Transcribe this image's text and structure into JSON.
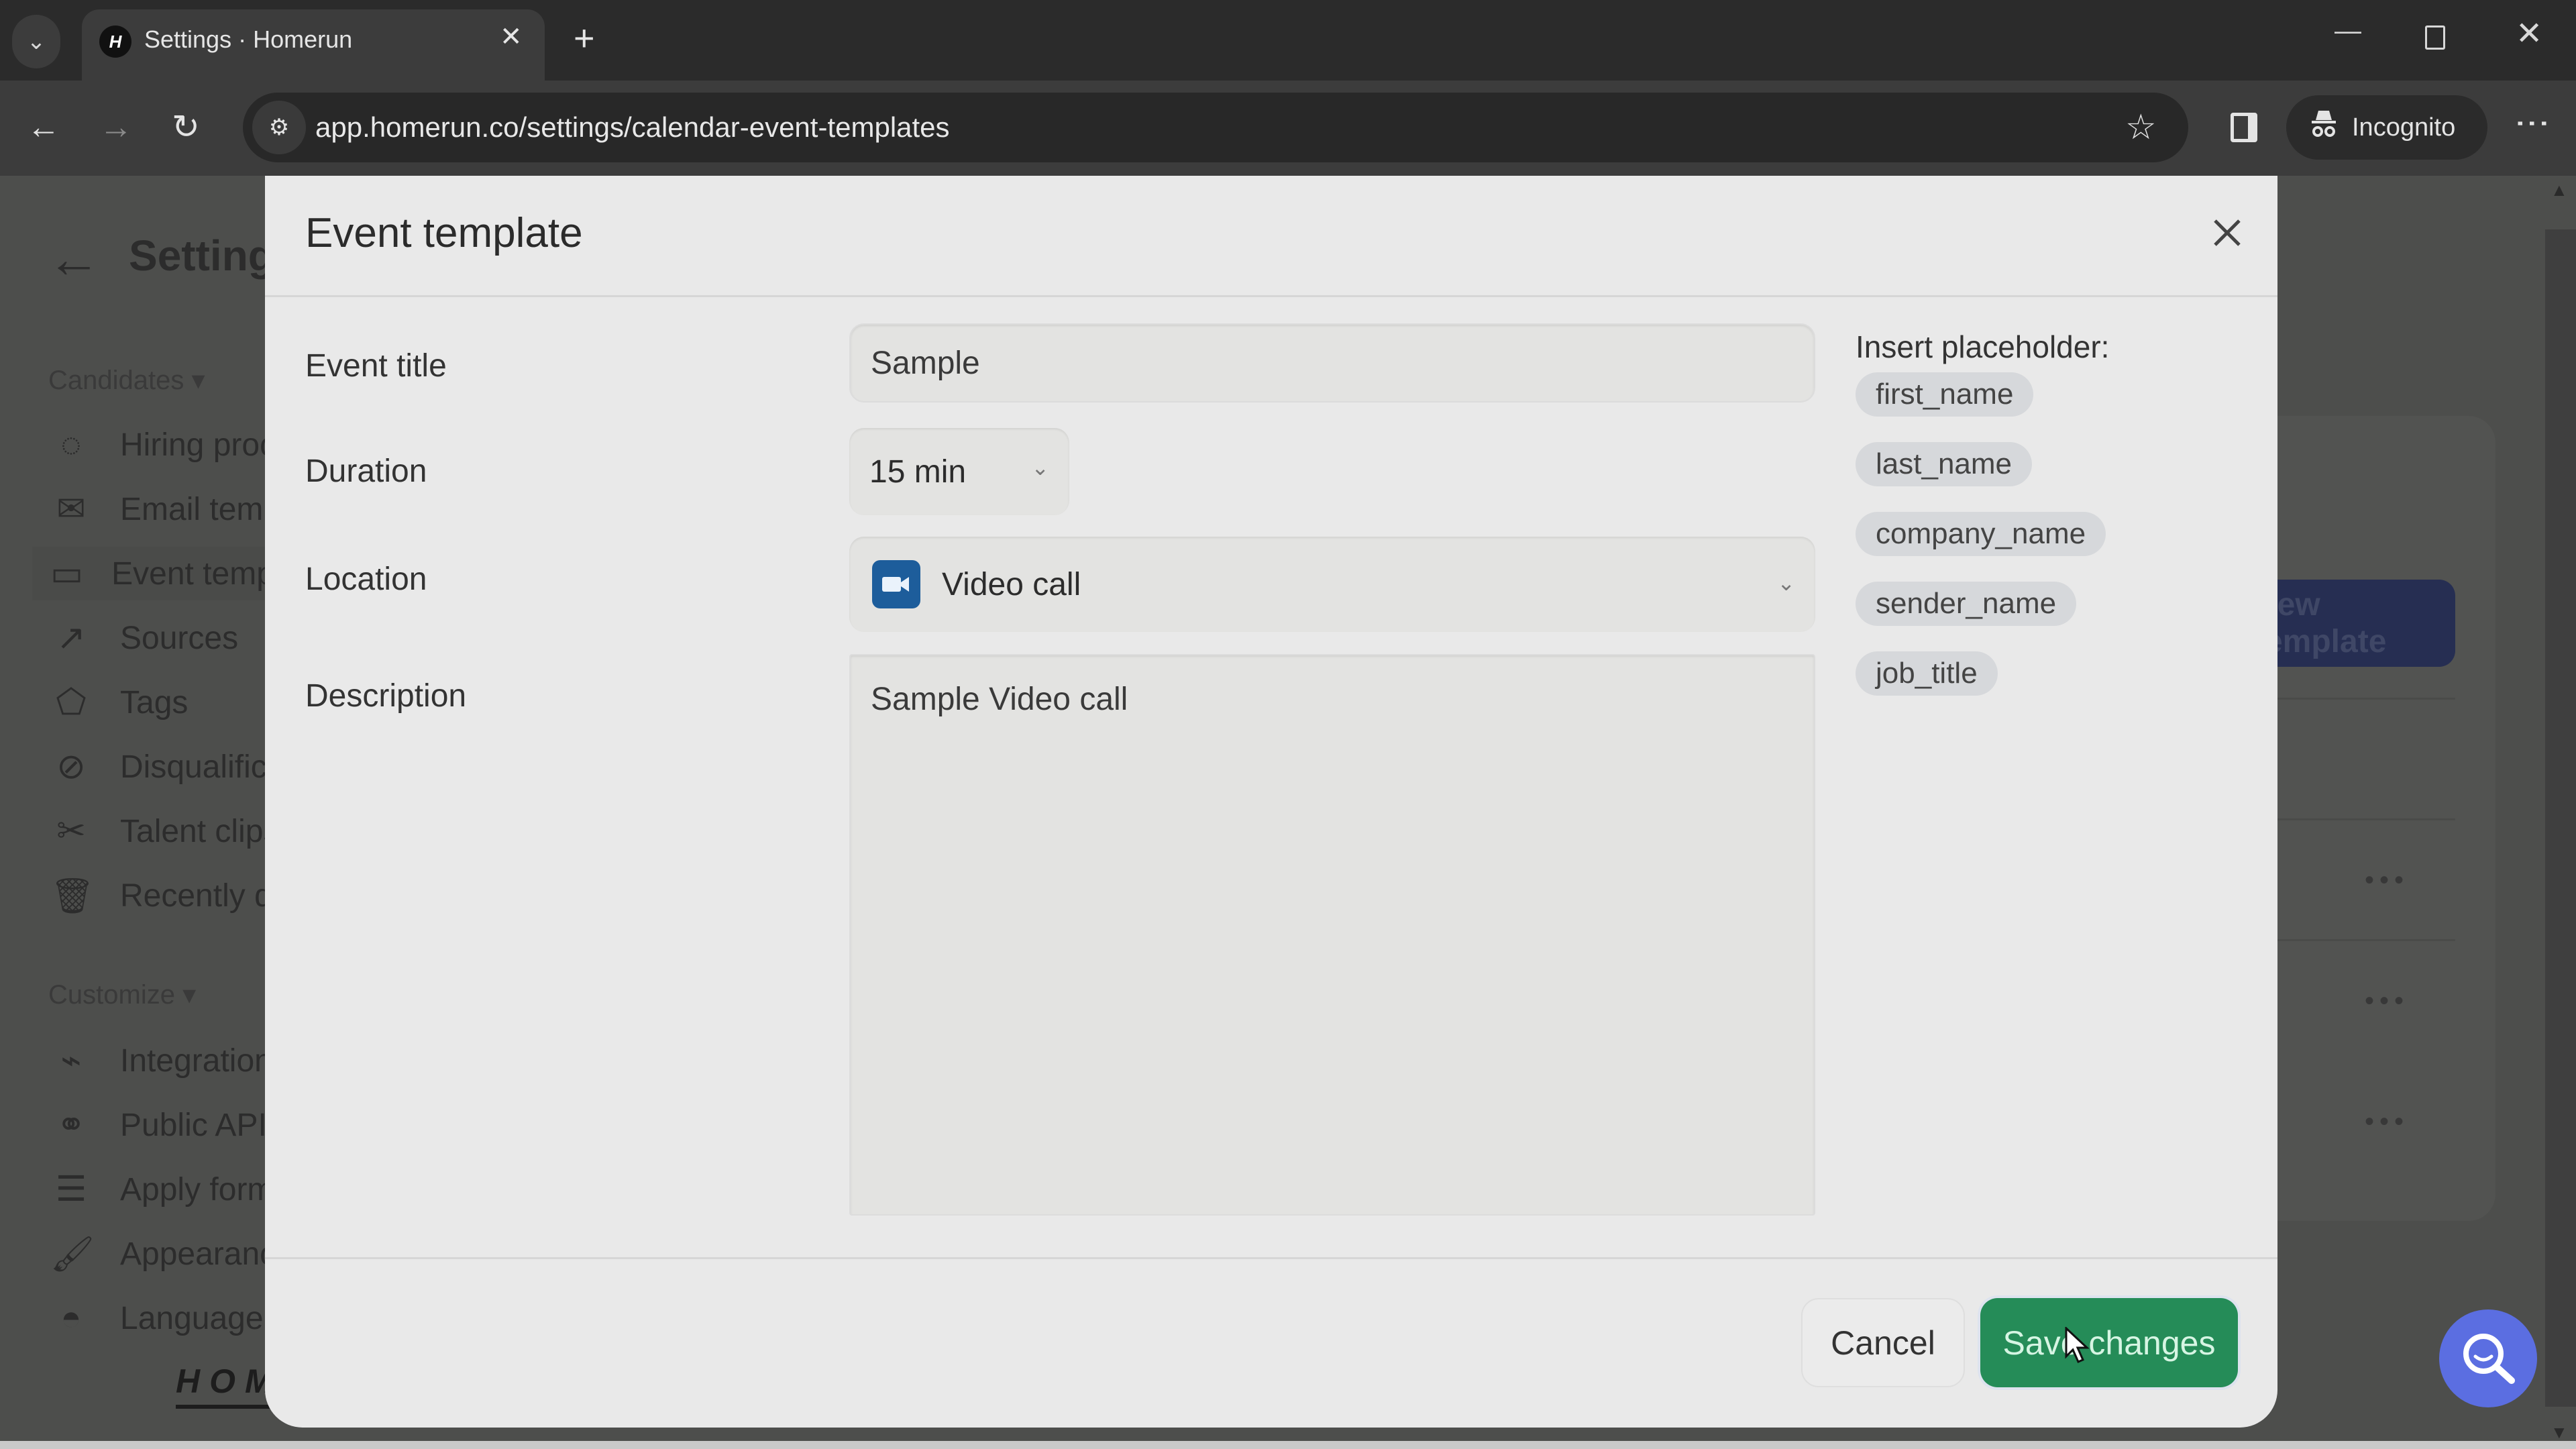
{
  "browser": {
    "tab_title": "Settings · Homerun",
    "favicon_letter": "H",
    "url": "app.homerun.co/settings/calendar-event-templates",
    "incognito_label": "Incognito"
  },
  "background": {
    "settings_title": "Settings",
    "sections": [
      {
        "label": "Candidates",
        "items": [
          {
            "label": "Hiring process",
            "icon": "hiring-process-icon"
          },
          {
            "label": "Email templates",
            "icon": "mail-icon"
          },
          {
            "label": "Event templates",
            "icon": "calendar-icon",
            "active": true
          },
          {
            "label": "Sources",
            "icon": "sources-icon"
          },
          {
            "label": "Tags",
            "icon": "tag-icon"
          },
          {
            "label": "Disqualification reasons",
            "icon": "disqualify-icon"
          },
          {
            "label": "Talent clips",
            "icon": "scissors-icon"
          },
          {
            "label": "Recently deleted",
            "icon": "trash-icon"
          }
        ]
      },
      {
        "label": "Customize",
        "items": [
          {
            "label": "Integrations",
            "icon": "plug-icon"
          },
          {
            "label": "Public API",
            "icon": "api-icon"
          },
          {
            "label": "Apply form",
            "icon": "checklist-icon"
          },
          {
            "label": "Appearance",
            "icon": "brush-icon"
          },
          {
            "label": "Language",
            "icon": "language-icon"
          }
        ]
      }
    ],
    "logo_text": "HOMERUN",
    "new_template_button": "New template"
  },
  "modal": {
    "title": "Event template",
    "fields": {
      "event_title": {
        "label": "Event title",
        "value": "Sample"
      },
      "duration": {
        "label": "Duration",
        "value": "15 min"
      },
      "location": {
        "label": "Location",
        "value": "Video call",
        "icon": "video-camera-icon"
      },
      "description": {
        "label": "Description",
        "value": "Sample Video call"
      }
    },
    "placeholders": {
      "heading": "Insert placeholder:",
      "chips": [
        "first_name",
        "last_name",
        "company_name",
        "sender_name",
        "job_title"
      ]
    },
    "footer": {
      "cancel_label": "Cancel",
      "save_label": "Save changes"
    }
  },
  "colors": {
    "save_green": "#258c58",
    "video_blue": "#1d5d9b",
    "help_fab": "#5b6ee1"
  }
}
